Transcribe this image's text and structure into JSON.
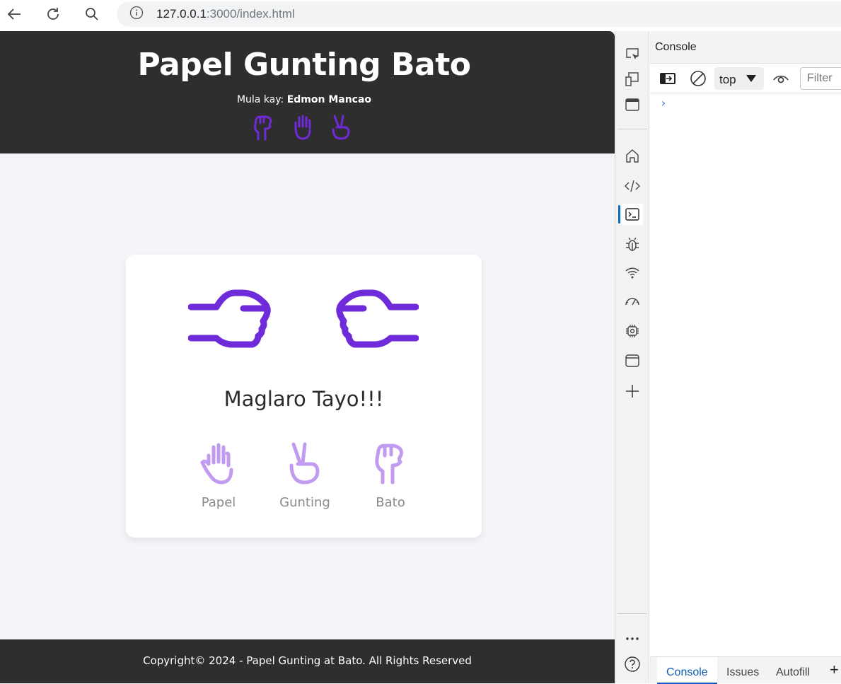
{
  "browser": {
    "url_host": "127.0.0.1",
    "url_path": ":3000/index.html",
    "icons": [
      "back-arrow-icon",
      "reload-icon",
      "search-icon",
      "site-info-icon"
    ]
  },
  "page": {
    "title": "Papel Gunting Bato",
    "byline_prefix": "Mula kay:",
    "byline_author": "Edmon Mancao",
    "header_icons": [
      "fist-icon",
      "open-hand-icon",
      "peace-hand-icon"
    ],
    "prompt": "Maglaro Tayo!!!",
    "choices": [
      {
        "label": "Papel",
        "icon": "open-hand-icon"
      },
      {
        "label": "Gunting",
        "icon": "peace-hand-icon"
      },
      {
        "label": "Bato",
        "icon": "fist-icon"
      }
    ],
    "footer": "Copyright© 2024 - Papel Gunting at Bato. All Rights Reserved",
    "accent_color": "#6f2bd9",
    "accent_light": "#c09bf0"
  },
  "devtools": {
    "panel_title": "Console",
    "context": "top",
    "filter_placeholder": "Filter",
    "drawer_tabs": [
      "Console",
      "Issues",
      "Autofill"
    ],
    "activity_icons": [
      "inspect-icon",
      "device-emulation-icon",
      "dock-icon",
      "welcome-home-icon",
      "elements-code-icon",
      "console-icon",
      "sources-bug-icon",
      "network-wifi-icon",
      "performance-gauge-icon",
      "memory-chip-icon",
      "application-window-icon",
      "add-tool-icon",
      "more-tools-icon",
      "help-icon"
    ]
  }
}
